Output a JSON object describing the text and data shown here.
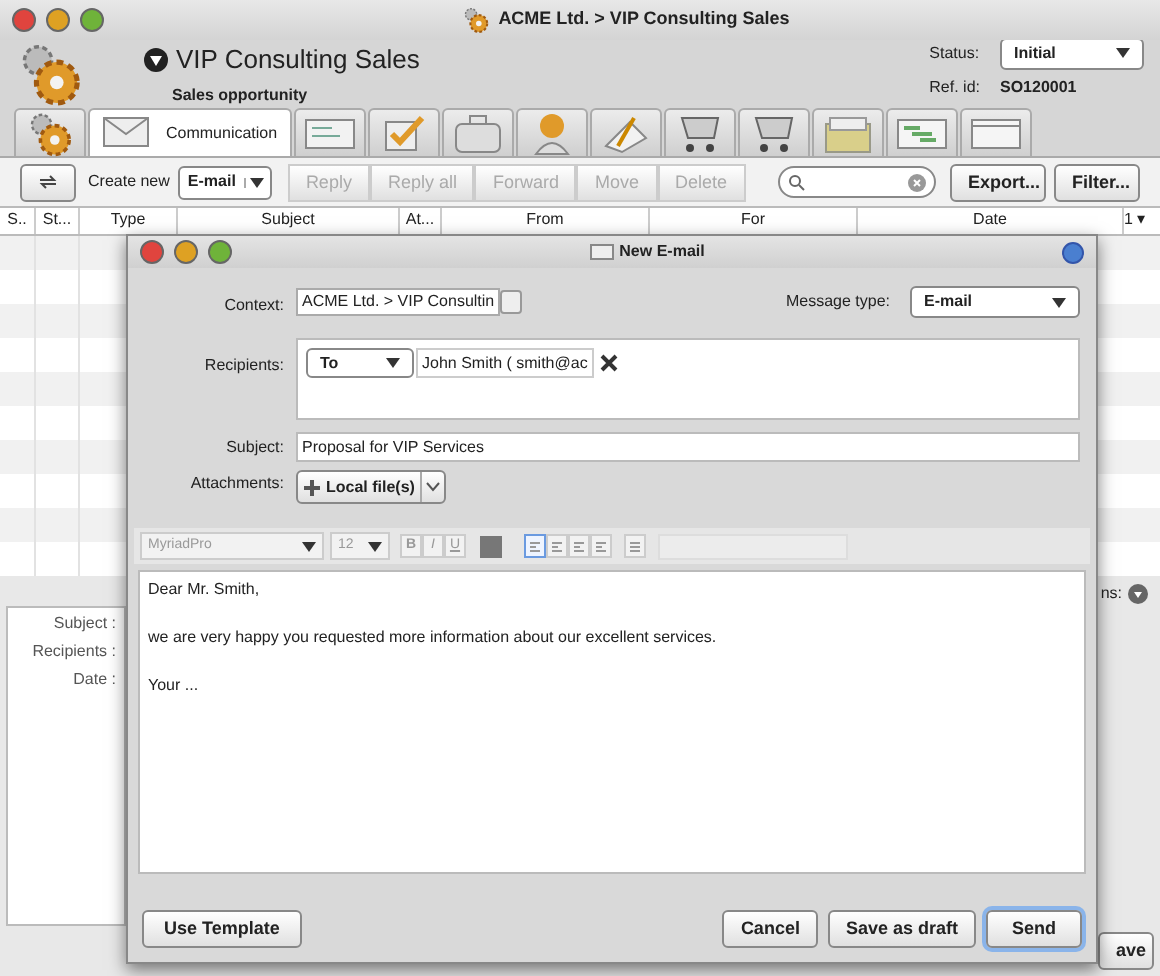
{
  "window": {
    "title": "ACME Ltd. > VIP Consulting Sales"
  },
  "header": {
    "title": "VIP Consulting Sales",
    "subtitle": "Sales opportunity",
    "status_label": "Status:",
    "status": "Initial",
    "ref_label": "Ref. id:",
    "ref": "SO120001"
  },
  "tabs": [
    {
      "selected": false
    },
    {
      "label": "Communication",
      "selected": true
    },
    {
      "selected": false
    },
    {
      "selected": false
    },
    {
      "selected": false
    },
    {
      "selected": false
    },
    {
      "selected": false
    },
    {
      "selected": false
    },
    {
      "selected": false
    },
    {
      "selected": false
    },
    {
      "selected": false
    },
    {
      "selected": false
    }
  ],
  "toolbar": {
    "create_label": "Create new",
    "create_type": "E-mail",
    "actions": [
      {
        "label": "Reply",
        "disabled": true
      },
      {
        "label": "Reply all",
        "disabled": true
      },
      {
        "label": "Forward",
        "disabled": true
      },
      {
        "label": "Move",
        "disabled": true
      },
      {
        "label": "Delete",
        "disabled": true
      }
    ],
    "export": "Export...",
    "filter": "Filter..."
  },
  "table": {
    "columns": [
      "S..",
      "St...",
      "Type",
      "Subject",
      "At...",
      "From",
      "For",
      "Date"
    ],
    "sort": "1 ▾"
  },
  "details": {
    "labels": [
      "Subject :",
      "Recipients :",
      "Date :"
    ],
    "options_label": "ns:",
    "save": "ave"
  },
  "dialog": {
    "title": "New E-mail",
    "context_label": "Context:",
    "context": "ACME Ltd. > VIP Consultin",
    "message_type_label": "Message type:",
    "message_type": "E-mail",
    "recipients_label": "Recipients:",
    "recipient_type": "To",
    "recipient": "John Smith ( smith@ac",
    "subject_label": "Subject:",
    "subject": "Proposal for VIP Services",
    "attachments_label": "Attachments:",
    "attach": "Local file(s)",
    "editor": {
      "font": "MyriadPro",
      "size": "12",
      "styles": [
        "B",
        "I",
        "U"
      ],
      "align": [
        {
          "selected": true
        },
        {
          "selected": false
        },
        {
          "selected": false
        },
        {
          "selected": false
        }
      ],
      "body": [
        "Dear Mr. Smith,",
        "we are very happy you requested more information about our excellent services.",
        "Your ..."
      ]
    },
    "buttons": [
      {
        "label": "Use Template",
        "default": false
      },
      {
        "label": "Cancel",
        "default": false
      },
      {
        "label": "Save as draft",
        "default": false
      },
      {
        "label": "Send",
        "default": true
      }
    ]
  }
}
